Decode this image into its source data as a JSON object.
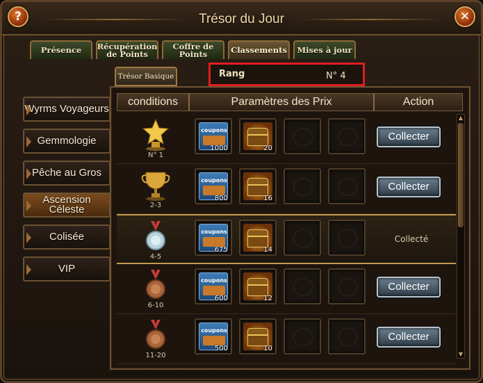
{
  "window": {
    "title": "Trésor du Jour",
    "help_label": "?",
    "close_label": "✕"
  },
  "tabs": [
    {
      "label": "Présence"
    },
    {
      "label": "Récupération de Points"
    },
    {
      "label": "Coffre de Points"
    },
    {
      "label": "Classements",
      "active": true
    },
    {
      "label": "Mises à jour"
    }
  ],
  "sub_tab": {
    "label": "Trésor Basique"
  },
  "rank": {
    "label": "Rang",
    "value": "N° 4"
  },
  "side_menu": [
    {
      "label": "Wyrms Voyageurs"
    },
    {
      "label": "Gemmologie"
    },
    {
      "label": "Pêche au Gros"
    },
    {
      "label": "Ascension Céleste",
      "active": true
    },
    {
      "label": "Colisée"
    },
    {
      "label": "VIP"
    }
  ],
  "table": {
    "headers": {
      "conditions": "conditions",
      "prizes": "Paramètres des Prix",
      "action": "Action"
    },
    "coupon_label": "coupons",
    "rows": [
      {
        "rank": "N° 1",
        "icon": "star-trophy-icon",
        "coupons": "1000",
        "chests": "20",
        "action": "Collecter",
        "collected": false
      },
      {
        "rank": "2-3",
        "icon": "cup-trophy-icon",
        "coupons": "800",
        "chests": "16",
        "action": "Collecter",
        "collected": false
      },
      {
        "rank": "4-5",
        "icon": "silver-medal-icon",
        "coupons": "675",
        "chests": "14",
        "action": "Collecté",
        "collected": true
      },
      {
        "rank": "6-10",
        "icon": "bronze-medal-icon",
        "coupons": "600",
        "chests": "12",
        "action": "Collecter",
        "collected": false
      },
      {
        "rank": "11-20",
        "icon": "bronze-medal-icon",
        "coupons": "500",
        "chests": "10",
        "action": "Collecter",
        "collected": false
      }
    ]
  },
  "colors": {
    "accent": "#e11d22",
    "gold": "#c49a50"
  }
}
